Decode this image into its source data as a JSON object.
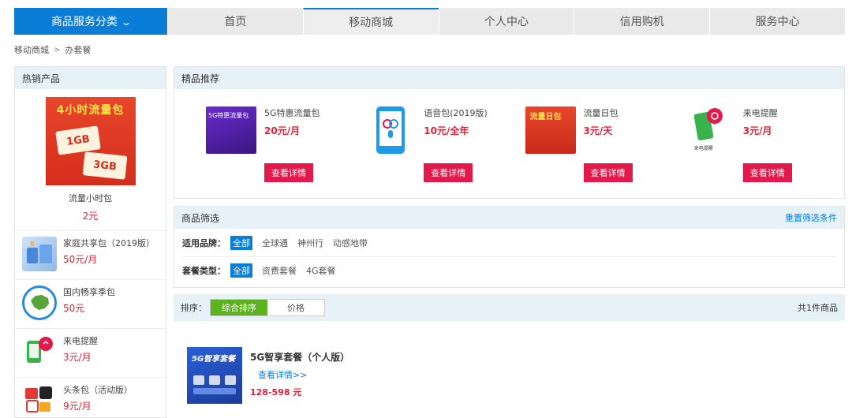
{
  "nav": {
    "category_label": "商品服务分类",
    "tabs": [
      "首页",
      "移动商城",
      "个人中心",
      "信用购机",
      "服务中心"
    ],
    "active_tab": 1
  },
  "breadcrumb": {
    "root": "移动商城",
    "current": "办套餐"
  },
  "hot": {
    "title": "热销产品",
    "feature": {
      "banner_text": "4小时流量包",
      "tag1": "1GB",
      "tag2": "3GB",
      "name": "流量小时包",
      "price": "2元"
    },
    "items": [
      {
        "name": "家庭共享包（2019版）",
        "price": "50元/月",
        "icon": "family-share-image"
      },
      {
        "name": "国内畅享季包",
        "price": "50元",
        "icon": "china-map-image"
      },
      {
        "name": "来电提醒",
        "price": "3元/月",
        "icon": "phone-alert-image"
      },
      {
        "name": "头条包（活动版）",
        "price": "9元/月",
        "icon": "apps-bundle-image"
      }
    ]
  },
  "recommend": {
    "title": "精品推荐",
    "detail_label": "查看详情",
    "cards": [
      {
        "name": "5G特惠流量包",
        "price": "20元/月",
        "icon": "5g-flow-image",
        "thumb_text": "5G特惠流量包"
      },
      {
        "name": "语音包(2019版)",
        "price": "10元/全年",
        "icon": "voice-phone-image"
      },
      {
        "name": "流量日包",
        "price": "3元/天",
        "icon": "daily-flow-image",
        "thumb_text": "流量日包"
      },
      {
        "name": "来电提醒",
        "price": "3元/月",
        "icon": "call-reminder-image",
        "thumb_text": "来电提醒"
      }
    ]
  },
  "filter": {
    "title": "商品筛选",
    "reset": "重置筛选条件",
    "brand_label": "适用品牌：",
    "brand_options": [
      "全部",
      "全球通",
      "神州行",
      "动感地带"
    ],
    "type_label": "套餐类型：",
    "type_options": [
      "全部",
      "资费套餐",
      "4G套餐"
    ]
  },
  "sort": {
    "label": "排序：",
    "options": [
      "综合排序",
      "价格"
    ],
    "active": 0,
    "count": "共1件商品"
  },
  "product": {
    "name": "5G智享套餐（个人版）",
    "detail": "查看详情>>",
    "price": "128-598 元",
    "thumb_text": "5G智享套餐"
  },
  "colors": {
    "accent": "#0a7dd6",
    "price": "#e0203a",
    "button": "#e4194b",
    "sort_active": "#5bb31d",
    "panel_head": "#e6f2f8"
  }
}
